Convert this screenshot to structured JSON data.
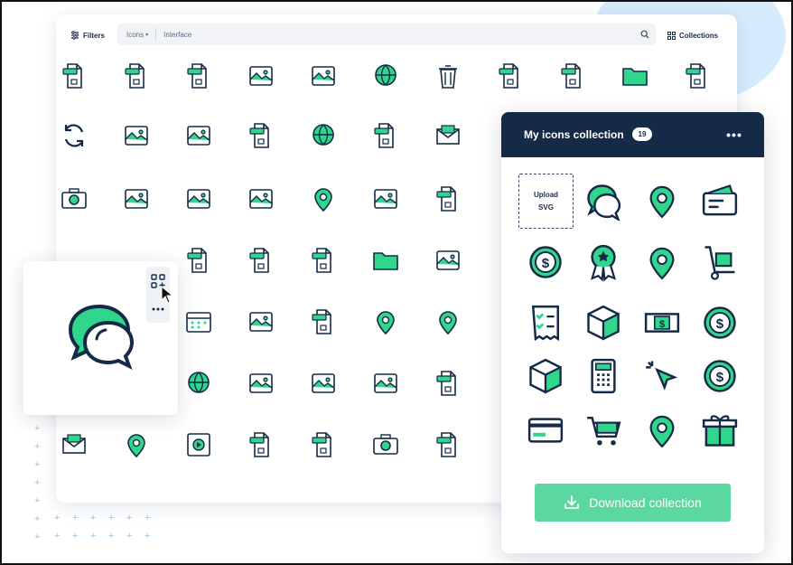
{
  "toolbar": {
    "filters_label": "Filters",
    "type_select": "Icons",
    "search_value": "Interface",
    "collections_label": "Collections"
  },
  "icon_grid": [
    [
      "file-wav-icon",
      "file-wmv-icon",
      "file-aiff-icon",
      "document-stack-icon",
      "drawing-frame-icon",
      "globe-stand-icon",
      "trash-bin-icon",
      "file-pptx-icon",
      "file-dpt-icon",
      "folder-icon",
      "file-mpeg-icon"
    ],
    [
      "refresh-icon",
      "cloud-network-icon",
      "image-frame-icon",
      "file-mid-icon",
      "globe-icon",
      "file-nmo-icon",
      "mail-open-icon"
    ],
    [
      "camera-icon",
      "browser-globe-icon",
      "payment-terminal-icon",
      "landscape-frame-icon",
      "location-pin-icon",
      "compass-star-icon",
      "file-aac-icon"
    ],
    [
      "file-m4a-icon",
      "file-ai-icon",
      "file-doc-icon",
      "folder-open-icon",
      "images-stack-icon"
    ],
    [
      "calendar-icon",
      "hierarchy-icon",
      "file-exe-icon",
      "map-pin-folded-icon",
      "sliders-pins-icon"
    ],
    [
      "globe-small-icon",
      "network-nodes-icon",
      "user-portrait-icon",
      "photo-gallery-icon",
      "file-grid-icon"
    ],
    [
      "fast-mail-icon",
      "map-pin-small-icon",
      "video-film-icon",
      "file-mp3-icon",
      "file-ptx-icon",
      "camera-compact-icon",
      "file-video-icon"
    ]
  ],
  "detail_card": {
    "icon": "chat-bubbles-icon",
    "add_icon": "add-to-collection-icon",
    "more_icon": "more-dots-icon"
  },
  "collection": {
    "title": "My icons collection",
    "count": "19",
    "menu": "•••",
    "upload_line1": "Upload",
    "upload_line2": "SVG",
    "icons": [
      "chat-bubbles-icon",
      "shopping-bag-add-icon",
      "wallet-cards-icon",
      "dollar-monitor-icon",
      "award-badge-icon",
      "shopping-cart-icon",
      "hand-truck-icon",
      "receipt-checklist-icon",
      "package-box-icon",
      "cash-bill-icon",
      "coin-stack-icon",
      "delivery-box-icon",
      "calculator-icon",
      "cursor-click-icon",
      "dollar-coin-icon",
      "credit-card-icon",
      "cart-download-icon",
      "location-pin-icon",
      "gift-box-icon"
    ],
    "download_label": "Download collection"
  },
  "colors": {
    "navy": "#152a47",
    "green": "#2fd68c",
    "button_green": "#5bd89f",
    "blue_accent": "#d6ecfc"
  }
}
